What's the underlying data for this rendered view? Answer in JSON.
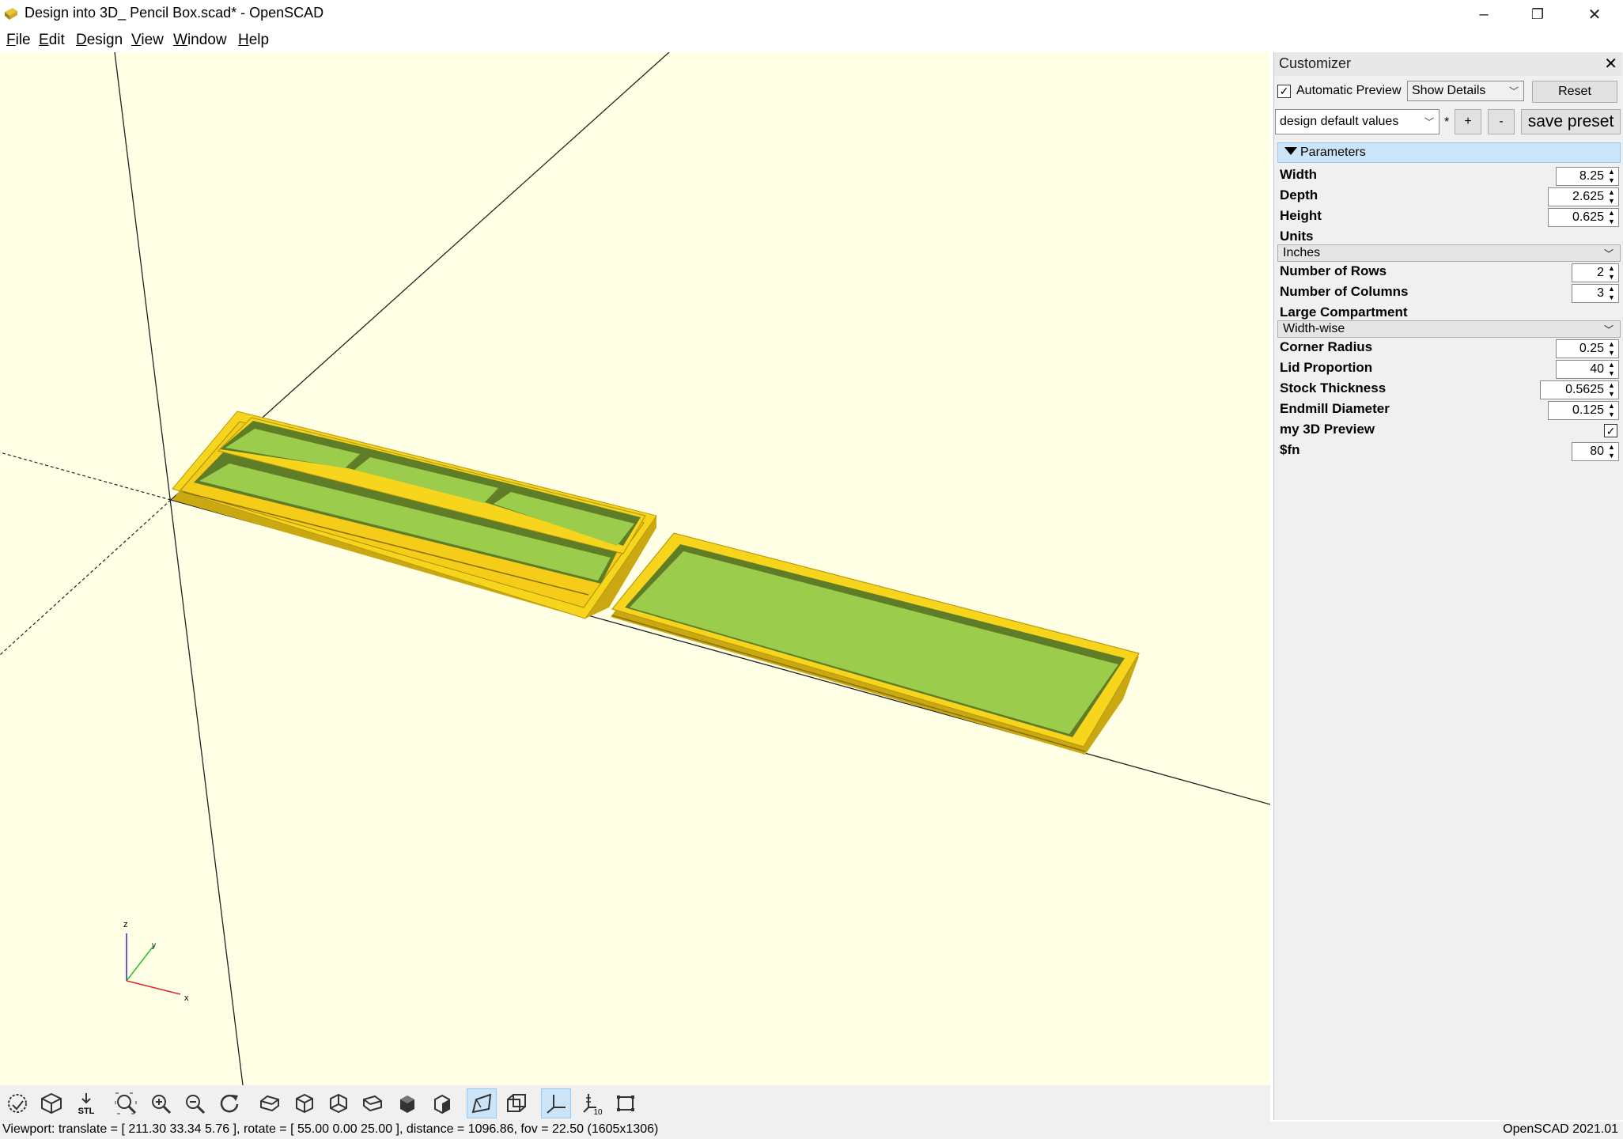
{
  "window": {
    "title": "Design into 3D_ Pencil Box.scad* - OpenSCAD",
    "minimize": "–",
    "restore": "❐",
    "close": "✕"
  },
  "menu": {
    "file": {
      "u": "F",
      "rest": "ile"
    },
    "edit": {
      "u": "E",
      "rest": "dit"
    },
    "design": {
      "u": "D",
      "rest": "esign"
    },
    "view": {
      "u": "V",
      "rest": "iew"
    },
    "window": {
      "u": "W",
      "rest": "indow"
    },
    "help": {
      "u": "H",
      "rest": "elp"
    }
  },
  "axes_indicator": {
    "z": "z",
    "y": "y",
    "x": "x"
  },
  "toolbar_icons": [
    "preview-icon",
    "render-icon",
    "export-stl-icon",
    "view-all-icon",
    "zoom-in-icon",
    "zoom-out-icon",
    "reset-view-icon",
    "view-right-icon",
    "view-top-icon",
    "view-bottom-icon",
    "view-left-icon",
    "view-front-icon",
    "view-back-icon",
    "perspective-icon",
    "orthogonal-icon",
    "show-axes-icon",
    "show-scale-markers-icon",
    "show-edges-icon"
  ],
  "toolbar": {
    "stl": "STL",
    "scale_num": "10"
  },
  "status": {
    "viewport": "Viewport: translate = [ 211.30 33.34 5.76 ], rotate = [ 55.00 0.00 25.00 ], distance = 1096.86, fov = 22.50 (1605x1306)",
    "version": "OpenSCAD 2021.01"
  },
  "customizer": {
    "title": "Customizer",
    "close": "✕",
    "auto_preview_label": "Automatic Preview",
    "auto_preview_checked": "✓",
    "details_mode": "Show Details",
    "reset_label": "Reset",
    "preset": "design default values",
    "preset_modified": "*",
    "add_preset": "+",
    "remove_preset": "-",
    "save_preset": "save preset",
    "params_header": "Parameters",
    "params": {
      "width": {
        "label": "Width",
        "value": "8.25"
      },
      "depth": {
        "label": "Depth",
        "value": "2.625"
      },
      "height": {
        "label": "Height",
        "value": "0.625"
      },
      "units": {
        "label": "Units",
        "value": "Inches"
      },
      "rows": {
        "label": "Number of Rows",
        "value": "2"
      },
      "columns": {
        "label": "Number of Columns",
        "value": "3"
      },
      "large_compartment": {
        "label": "Large Compartment",
        "value": "Width-wise"
      },
      "corner_radius": {
        "label": "Corner Radius",
        "value": "0.25"
      },
      "lid_proportion": {
        "label": "Lid Proportion",
        "value": "40"
      },
      "stock_thickness": {
        "label": "Stock Thickness",
        "value": "0.5625"
      },
      "endmill_diameter": {
        "label": "Endmill Diameter",
        "value": "0.125"
      },
      "my_3d_preview": {
        "label": "my 3D Preview",
        "checked": "✓"
      },
      "fn": {
        "label": "$fn",
        "value": "80"
      }
    }
  },
  "colors": {
    "viewport_bg": "#ffffe6",
    "model_face": "#9ccc4b",
    "model_rim": "#f7d51d",
    "model_side": "#c9a812",
    "selection": "#cce4f7"
  }
}
